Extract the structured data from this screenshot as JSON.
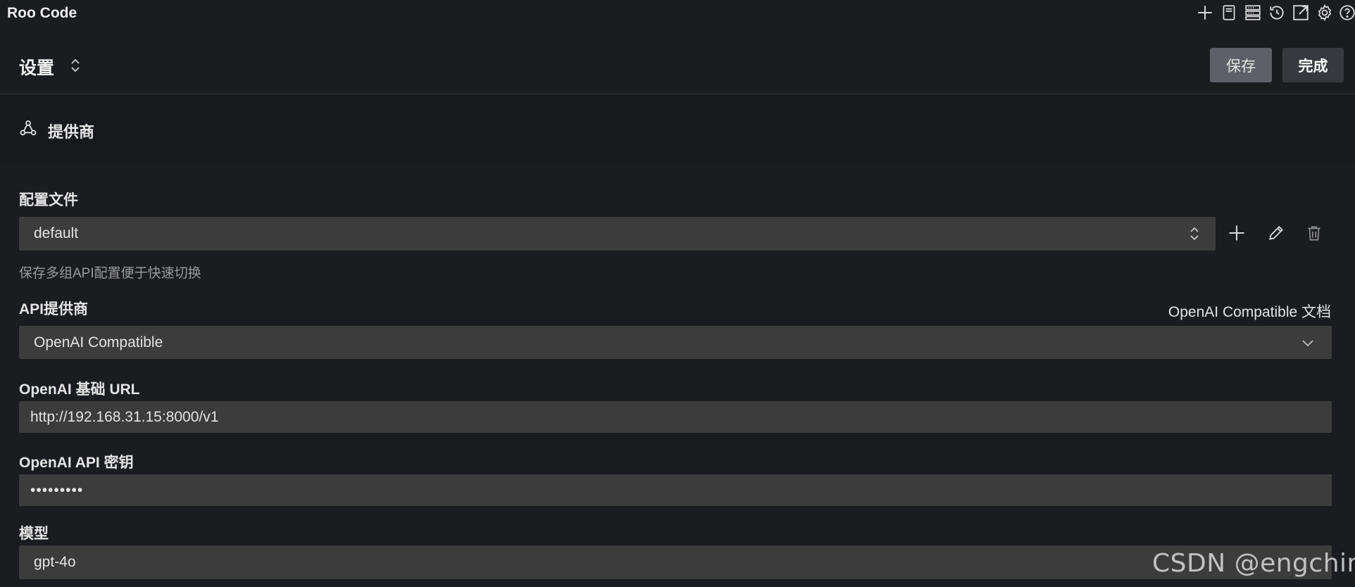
{
  "app": {
    "title": "Roo Code"
  },
  "toolbar": {
    "icons": [
      "plus-icon",
      "notebook-icon",
      "server-stack-icon",
      "history-icon",
      "external-link-icon",
      "gear-icon",
      "help-icon"
    ]
  },
  "settings": {
    "title": "设置",
    "save_label": "保存",
    "done_label": "完成"
  },
  "section": {
    "title": "提供商",
    "icon": "webhook-icon"
  },
  "profile": {
    "label": "配置文件",
    "value": "default",
    "help": "保存多组API配置便于快速切换"
  },
  "provider": {
    "label": "API提供商",
    "doc_link": "OpenAI Compatible 文档",
    "value": "OpenAI Compatible"
  },
  "base_url": {
    "label": "OpenAI 基础 URL",
    "value": "http://192.168.31.15:8000/v1"
  },
  "api_key": {
    "label": "OpenAI API 密钥",
    "value": "•••••••••"
  },
  "model": {
    "label": "模型",
    "value": "gpt-4o"
  },
  "watermark": "CSDN @engchina",
  "colors": {
    "background": "#1b1c20",
    "field": "#3c3c3c",
    "save_button": "#5d6066",
    "done_button": "#37393e"
  }
}
